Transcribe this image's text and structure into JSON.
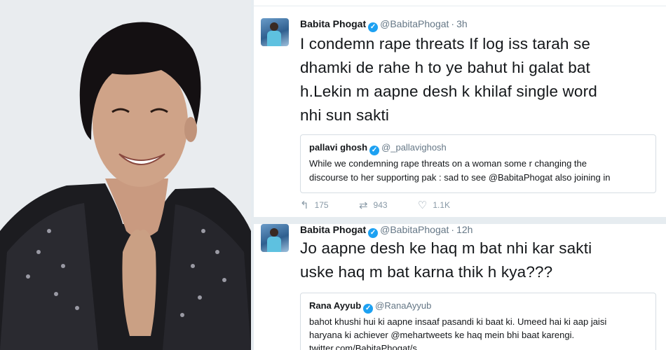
{
  "photo": {
    "subject_icon": "person-photo"
  },
  "tweets": [
    {
      "name": "Babita Phogat",
      "handle": "@BabitaPhogat",
      "time": "3h",
      "text_lines": [
        "I condemn rape threats If log iss tarah se",
        "dhamki de rahe h to ye bahut hi galat bat",
        "h.Lekin m aapne desh k khilaf single word",
        "nhi sun sakti"
      ],
      "quote": {
        "name": "pallavi ghosh",
        "handle": "@_pallavighosh",
        "text_lines": [
          "While we condemning rape threats on a woman some r changing the",
          "discourse to her supporting pak : sad to see @BabitaPhogat also joining in"
        ]
      },
      "actions": {
        "replies": "175",
        "retweets": "943",
        "likes": "1.1K"
      }
    },
    {
      "name": "Babita Phogat",
      "handle": "@BabitaPhogat",
      "time": "12h",
      "text_lines": [
        "Jo aapne desh ke haq m bat nhi kar sakti",
        "uske haq m bat karna thik h kya???"
      ],
      "quote": {
        "name": "Rana Ayyub",
        "handle": "@RanaAyyub",
        "text_lines": [
          "bahot khushi hui ki aapne insaaf pasandi ki baat ki. Umeed hai ki aap jaisi",
          "haryana ki achiever @mehartweets ke haq mein bhi baat karengi.",
          "twitter.com/BabitaPhogat/s..."
        ]
      }
    }
  ],
  "colors": {
    "verified": "#1da1f2",
    "text": "#14171a",
    "muted": "#657786",
    "separator": "#e6ecf0"
  }
}
